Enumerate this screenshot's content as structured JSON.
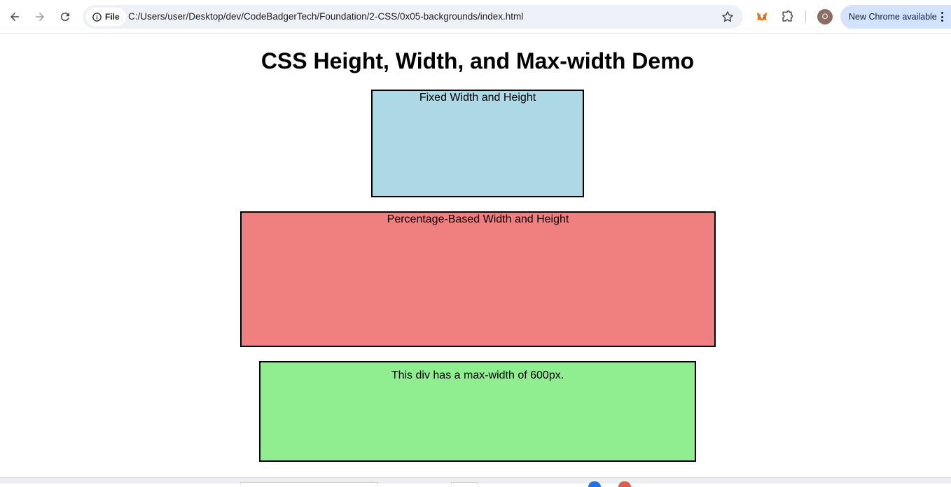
{
  "browser": {
    "file_chip_label": "File",
    "url": "C:/Users/user/Desktop/dev/CodeBadgerTech/Foundation/2-CSS/0x05-backgrounds/index.html",
    "profile_initial": "O",
    "update_label": "New Chrome available",
    "icons": {
      "back": "arrow-left-icon",
      "forward": "arrow-right-icon",
      "reload": "reload-icon",
      "info": "info-icon",
      "bookmark": "star-icon",
      "metamask": "fox-icon",
      "extensions": "puzzle-icon",
      "menu": "kebab-menu-icon"
    }
  },
  "page": {
    "title": "CSS Height, Width, and Max-width Demo",
    "boxes": [
      {
        "label": "Fixed Width and Height",
        "color": "#add8e6"
      },
      {
        "label": "Percentage-Based Width and Height",
        "color": "#f08080"
      },
      {
        "label": "This div has a max-width of 600px.",
        "color": "#90ee90"
      }
    ]
  },
  "colors": {
    "omnibox_bg": "#eef1f8",
    "update_chip_bg": "#d3e3fd",
    "avatar_bg": "#8d6e63"
  }
}
